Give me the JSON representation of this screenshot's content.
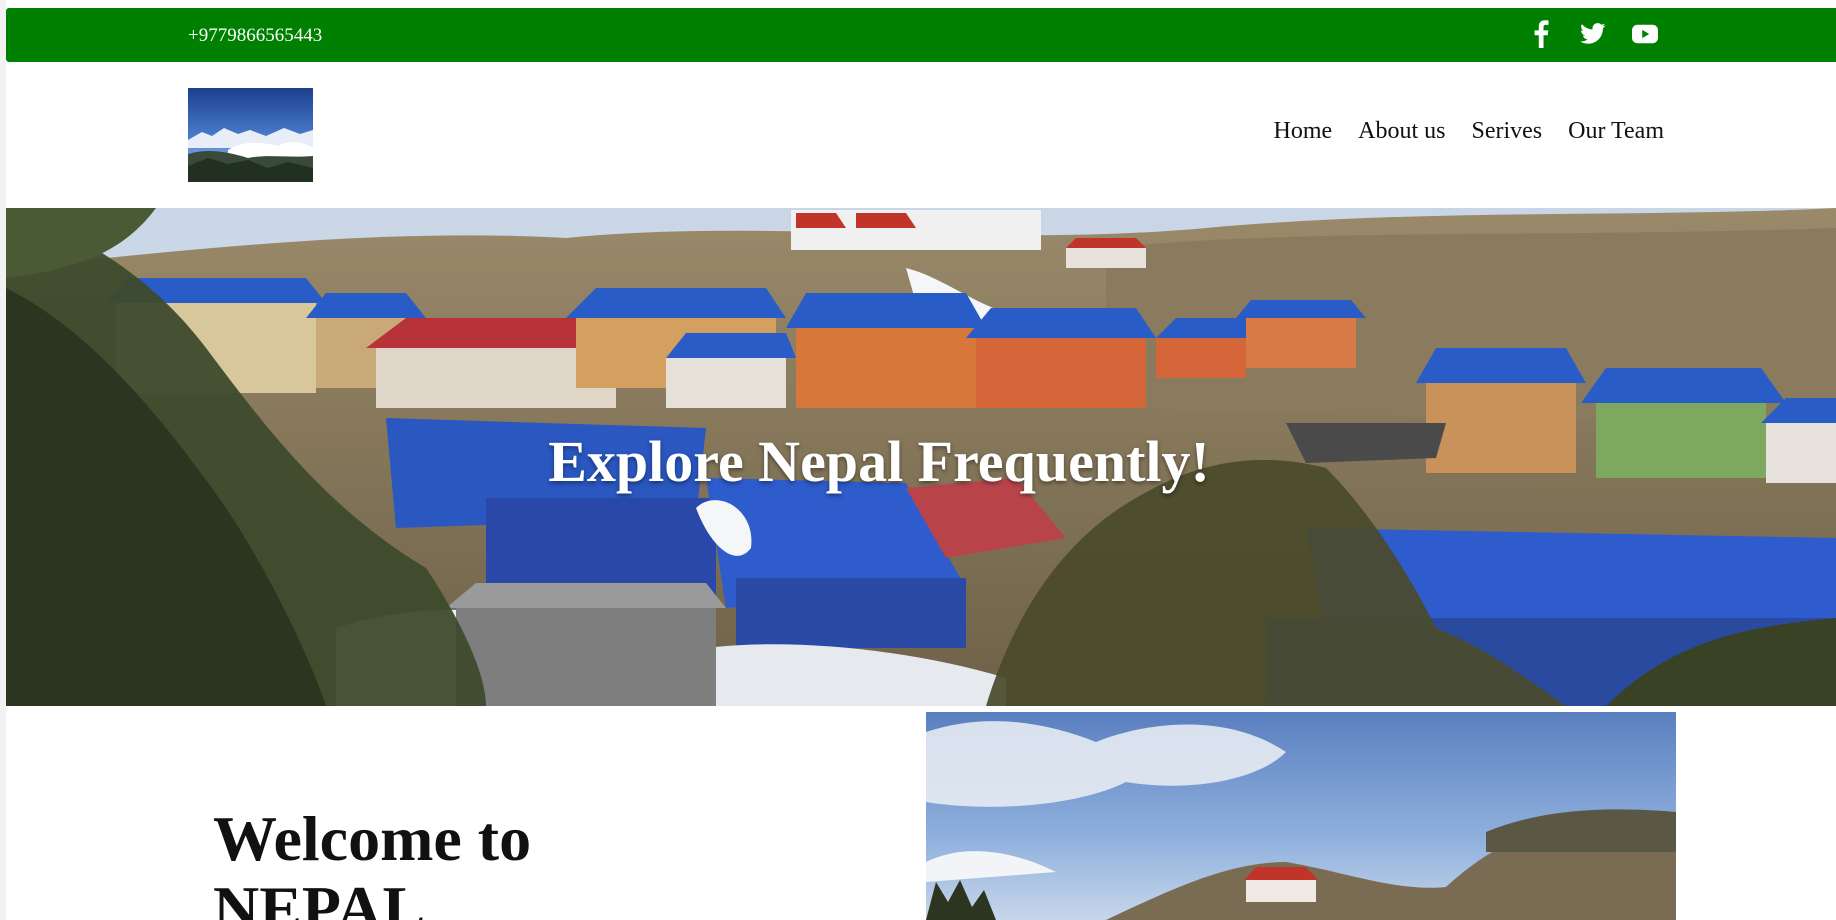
{
  "topbar": {
    "phone": "+9779866565443",
    "bg_color": "#008000",
    "social_icons": [
      "facebook-icon",
      "twitter-icon",
      "youtube-icon"
    ]
  },
  "header": {
    "logo_alt": "mountain-logo",
    "nav": [
      {
        "label": "Home"
      },
      {
        "label": "About us"
      },
      {
        "label": "Serives"
      },
      {
        "label": "Our Team"
      }
    ]
  },
  "hero": {
    "title": "Explore Nepal Frequently!"
  },
  "welcome": {
    "line1": "Welcome to",
    "line2": "NEPAL"
  }
}
